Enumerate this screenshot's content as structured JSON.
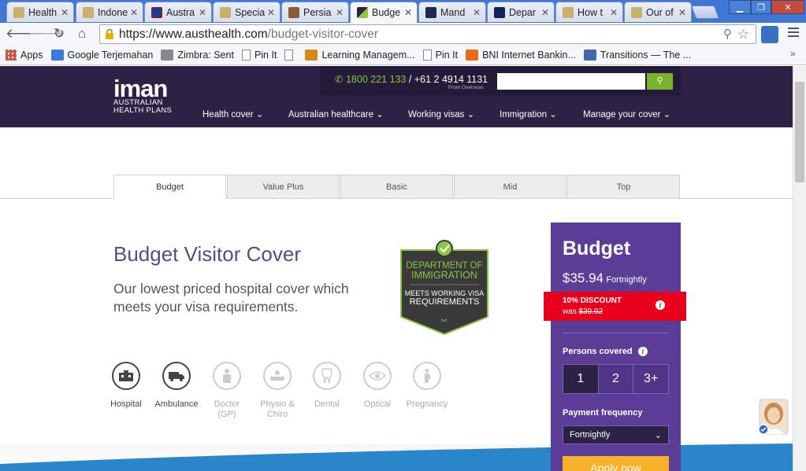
{
  "browser": {
    "tabs": [
      {
        "title": "Health",
        "active": false
      },
      {
        "title": "Indone",
        "active": false
      },
      {
        "title": "Austra",
        "active": false
      },
      {
        "title": "Specia",
        "active": false
      },
      {
        "title": "Persia",
        "active": false
      },
      {
        "title": "Budge",
        "active": true
      },
      {
        "title": "Mand",
        "active": false
      },
      {
        "title": "Depar",
        "active": false
      },
      {
        "title": "How t",
        "active": false
      },
      {
        "title": "Our of",
        "active": false
      }
    ],
    "url_host": "https://www.austhealth.com",
    "url_path": "/budget-visitor-cover",
    "bookmarks": [
      "Apps",
      "Google Terjemahan",
      "Zimbra: Sent",
      "Pin It",
      "",
      "Learning Managem...",
      "Pin It",
      "BNI Internet Bankin...",
      "Transitions — The ..."
    ]
  },
  "site": {
    "logo_word": "iman",
    "logo_sub1": "AUSTRALIAN",
    "logo_sub2": "HEALTH PLANS",
    "phone_local": "1800 221 133",
    "phone_sep": " / ",
    "phone_overseas": "+61 2 4914 1131",
    "overseas_label": "From Overseas",
    "nav": [
      "Health cover",
      "Australian healthcare",
      "Working visas",
      "Immigration",
      "Manage your cover"
    ]
  },
  "product_tabs": [
    "Budget",
    "Value Plus",
    "Basic",
    "Mid",
    "Top"
  ],
  "content": {
    "title": "Budget Visitor Cover",
    "lead": "Our lowest priced hospital cover which meets your visa requirements.",
    "badge_line1": "DEPARTMENT OF",
    "badge_line2": "IMMIGRATION",
    "badge_line3": "MEETS WORKING VISA",
    "badge_line4": "REQUIREMENTS",
    "features": [
      {
        "label": "Hospital",
        "label2": "",
        "included": true,
        "icon": "hospital-icon"
      },
      {
        "label": "Ambulance",
        "label2": "",
        "included": true,
        "icon": "ambulance-icon"
      },
      {
        "label": "Doctor",
        "label2": "(GP)",
        "included": false,
        "icon": "doctor-icon"
      },
      {
        "label": "Physio &",
        "label2": "Chiro",
        "included": false,
        "icon": "physio-icon"
      },
      {
        "label": "Dental",
        "label2": "",
        "included": false,
        "icon": "tooth-icon"
      },
      {
        "label": "Optical",
        "label2": "",
        "included": false,
        "icon": "eye-icon"
      },
      {
        "label": "Pregnancy",
        "label2": "",
        "included": false,
        "icon": "pregnancy-icon"
      }
    ]
  },
  "panel": {
    "title": "Budget",
    "price": "$35.94",
    "period": "Fortnightly",
    "discount_label": "10% DISCOUNT",
    "was_label": "was ",
    "was_price": "$39.92",
    "persons_label": "Persons covered",
    "persons_options": [
      "1",
      "2",
      "3+"
    ],
    "persons_selected": "1",
    "frequency_label": "Payment frequency",
    "frequency_value": "Fortnightly",
    "apply_label": "Apply now"
  },
  "colors": {
    "brand_purple": "#2d2145",
    "panel_purple": "#5b3d97",
    "accent_green": "#8dc63f",
    "discount_red": "#e8001c",
    "apply_orange": "#f8b12b"
  }
}
